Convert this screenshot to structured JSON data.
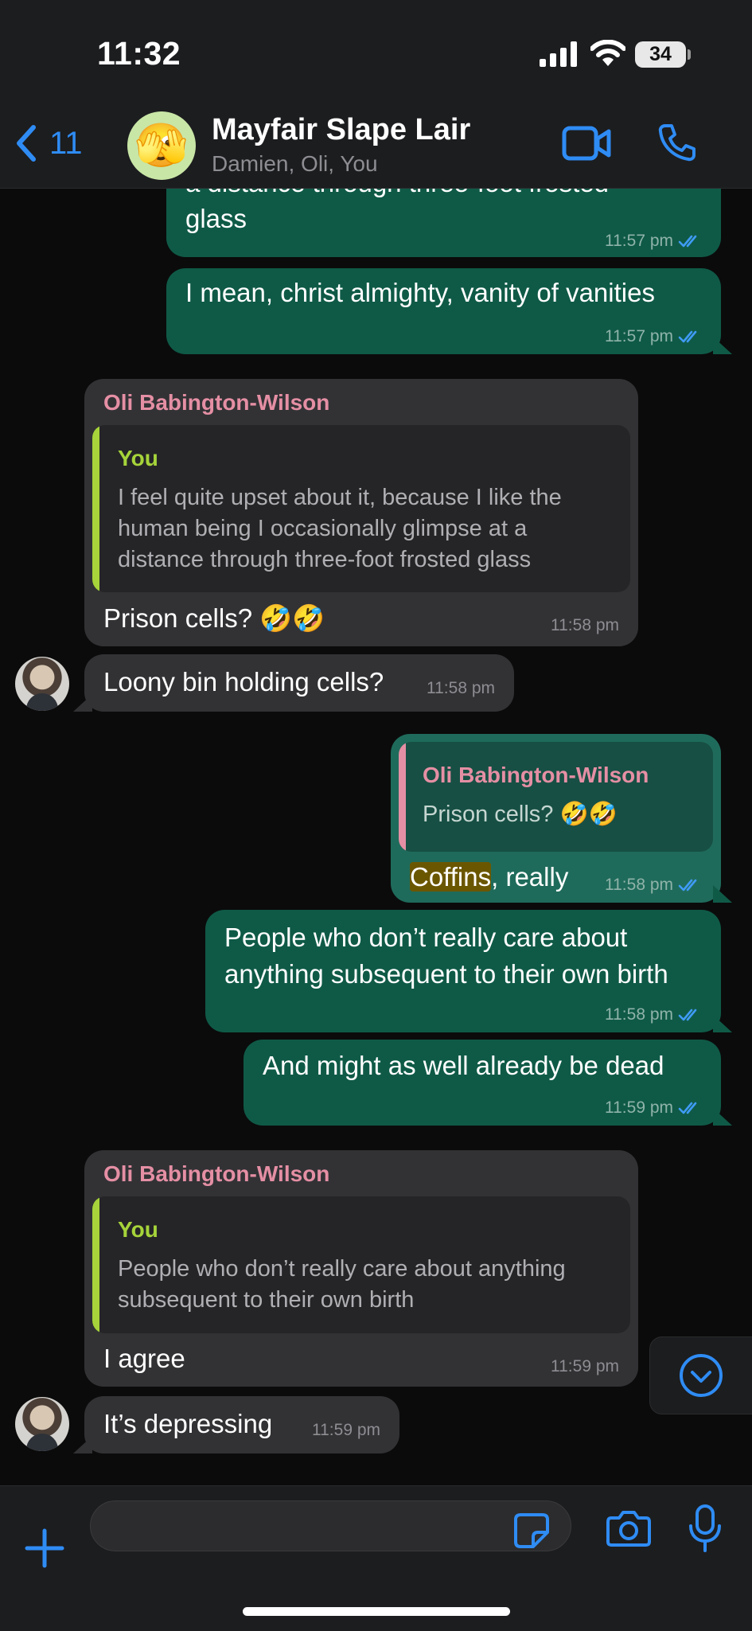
{
  "status_bar": {
    "time": "11:32",
    "battery": "34"
  },
  "header": {
    "back_count": "11",
    "avatar_emoji": "🫣",
    "group_name": "Mayfair Slape Lair",
    "members": "Damien, Oli, You"
  },
  "messages": [
    {
      "dir": "out",
      "lines": [
        "a distance through three-foot frosted",
        "glass"
      ],
      "time": "11:57 pm"
    },
    {
      "dir": "out",
      "text": "I mean, christ almighty, vanity of vanities",
      "time": "11:57 pm"
    },
    {
      "dir": "in",
      "sender": "Oli Babington-Wilson",
      "quote": {
        "name": "You",
        "lines": [
          "I feel quite upset about it, because I like the",
          "human being I occasionally glimpse at a",
          "distance through three-foot frosted glass"
        ]
      },
      "text": "Prison cells? 🤣🤣",
      "time": "11:58 pm"
    },
    {
      "dir": "in",
      "text": "Loony bin holding cells?",
      "time": "11:58 pm"
    },
    {
      "dir": "out",
      "quote": {
        "name": "Oli Babington-Wilson",
        "text": "Prison cells? 🤣🤣"
      },
      "text_highlight": "Coffins",
      "text_rest": ", really",
      "time": "11:58 pm"
    },
    {
      "dir": "out",
      "lines": [
        "People who don’t really care about",
        "anything subsequent to their own birth"
      ],
      "time": "11:58 pm"
    },
    {
      "dir": "out",
      "text": "And might as well already be dead",
      "time": "11:59 pm"
    },
    {
      "dir": "in",
      "sender": "Oli Babington-Wilson",
      "quote": {
        "name": "You",
        "lines": [
          "People who don’t really care about anything",
          "subsequent to their own birth"
        ]
      },
      "text": "I agree",
      "time": "11:59 pm"
    },
    {
      "dir": "in",
      "text": "It’s depressing",
      "time": "11:59 pm"
    }
  ],
  "composer": {
    "placeholder": ""
  },
  "colors": {
    "accent": "#2f8cf4",
    "outgoing_bubble": "#0f5a47",
    "incoming_bubble": "#323235",
    "sender_name": "#e58fa4",
    "quote_you": "#a6d43a",
    "quote_other": "#e58fa4"
  },
  "icons": [
    "back-chevron-icon",
    "video-call-icon",
    "phone-icon",
    "chevron-down-icon",
    "plus-icon",
    "sticker-icon",
    "camera-icon",
    "microphone-icon",
    "double-check-icon"
  ]
}
